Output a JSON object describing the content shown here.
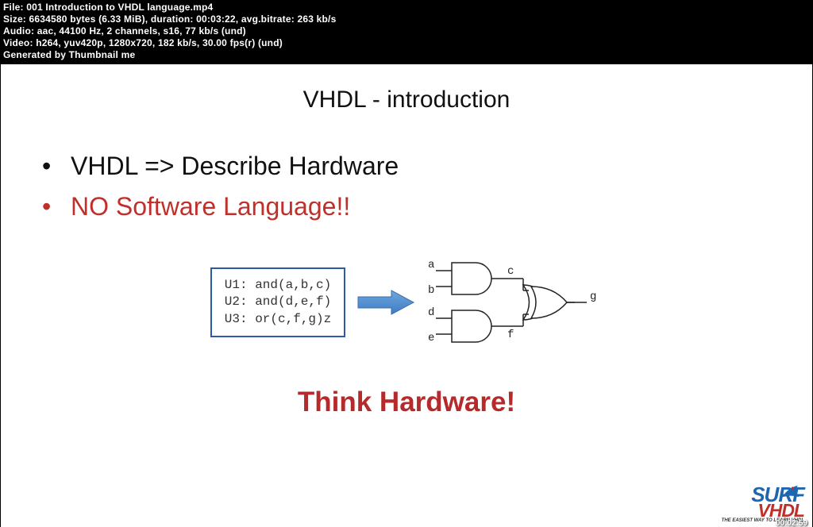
{
  "meta": {
    "file_label": "File:",
    "file": " 001 Introduction to VHDL language.mp4",
    "size_label": "Size:",
    "size": " 6634580 bytes (6.33 MiB), duration: 00:03:22, avg.bitrate: 263 kb/s",
    "audio_label": "Audio:",
    "audio": " aac, 44100 Hz, 2 channels, s16, 77 kb/s (und)",
    "video_label": "Video:",
    "video": " h264, yuv420p, 1280x720, 182 kb/s, 30.00 fps(r) (und)",
    "gen": "Generated by Thumbnail me"
  },
  "slide": {
    "title": "VHDL - introduction",
    "bullet1": "VHDL => Describe Hardware",
    "bullet2": "NO Software Language!!",
    "code_l1": "U1: and(a,b,c)",
    "code_l2": "U2: and(d,e,f)",
    "code_l3": "U3: or(c,f,g)z",
    "think": "Think Hardware!",
    "gate_labels": {
      "a": "a",
      "b": "b",
      "c": "c",
      "d": "d",
      "e": "e",
      "f": "f",
      "g": "g"
    }
  },
  "logo": {
    "l1": "SURF",
    "l2": "VHDL",
    "tag": "THE EASIEST WAY TO LEARN VHDL"
  },
  "timestamp": "00:02:59"
}
